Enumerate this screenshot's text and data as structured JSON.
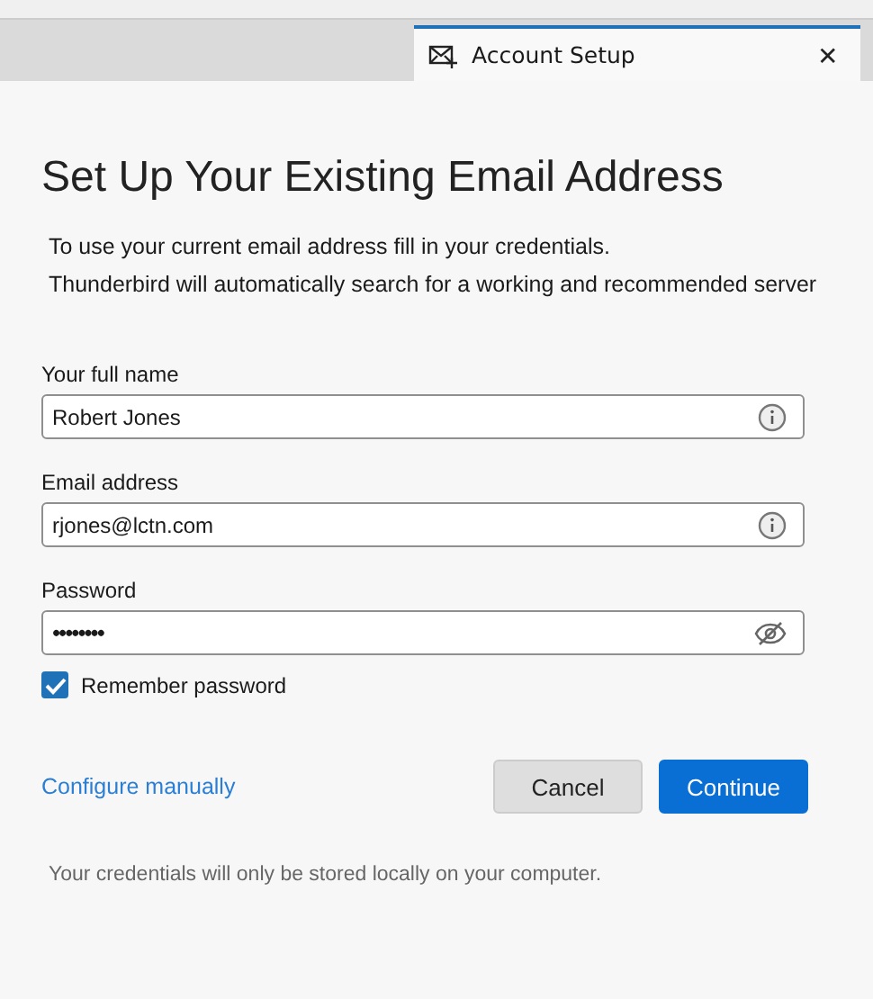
{
  "tab": {
    "title": "Account Setup",
    "close": "✕",
    "selected": true
  },
  "heading": "Set Up Your Existing Email Address",
  "intro": [
    "To use your current email address fill in your credentials.",
    "Thunderbird will automatically search for a working and recommended server"
  ],
  "fields": [
    {
      "label": "Your full name",
      "value": "Robert Jones",
      "kind": "info"
    },
    {
      "label": "Email address",
      "value": "rjones@lctn.com",
      "kind": "info"
    },
    {
      "label": "Password",
      "value": "••••••••",
      "kind": "password"
    }
  ],
  "remember": {
    "label": "Remember password",
    "checked": true
  },
  "link": "Configure manually",
  "buttons": [
    {
      "label": "Cancel",
      "kind": "secondary"
    },
    {
      "label": "Continue",
      "kind": "primary"
    }
  ],
  "note": "Your credentials will only be stored locally on your computer."
}
